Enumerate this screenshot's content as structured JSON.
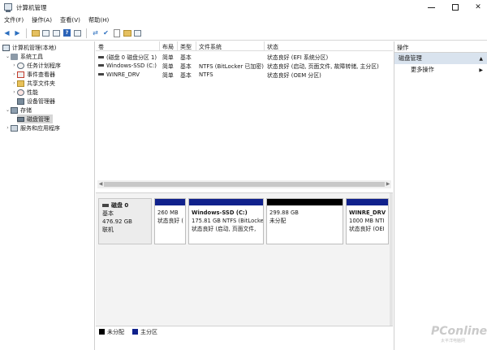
{
  "window": {
    "title": "计算机管理"
  },
  "menu": [
    "文件(F)",
    "操作(A)",
    "查看(V)",
    "帮助(H)"
  ],
  "tree": {
    "root": "计算机管理(本地)",
    "system_tools": "系统工具",
    "task_scheduler": "任务计划程序",
    "event_viewer": "事件查看器",
    "shared_folders": "共享文件夹",
    "performance": "性能",
    "device_manager": "设备管理器",
    "storage": "存储",
    "disk_management": "磁盘管理",
    "services": "服务和应用程序"
  },
  "columns": [
    "卷",
    "布局",
    "类型",
    "文件系统",
    "状态"
  ],
  "volumes": [
    {
      "name": "(磁盘 0 磁盘分区 1)",
      "layout": "简单",
      "type": "基本",
      "fs": "",
      "status": "状态良好 (EFI 系统分区)"
    },
    {
      "name": "Windows-SSD (C:)",
      "layout": "简单",
      "type": "基本",
      "fs": "NTFS (BitLocker 已加密)",
      "status": "状态良好 (启动, 页面文件, 故障转储, 主分区)"
    },
    {
      "name": "WINRE_DRV",
      "layout": "简单",
      "type": "基本",
      "fs": "NTFS",
      "status": "状态良好 (OEM 分区)"
    }
  ],
  "disk": {
    "name": "磁盘 0",
    "type": "基本",
    "size": "476.92 GB",
    "status": "联机"
  },
  "partitions": [
    {
      "title": "",
      "size": "260 MB",
      "status": "状态良好 (",
      "kind": "primary"
    },
    {
      "title": "Windows-SSD  (C:)",
      "size": "175.81 GB NTFS (BitLocke",
      "status": "状态良好 (启动, 页面文件,",
      "kind": "primary"
    },
    {
      "title": "",
      "size": "299.88 GB",
      "status": "未分配",
      "kind": "unalloc"
    },
    {
      "title": "WINRE_DRV",
      "size": "1000 MB NTI",
      "status": "状态良好 (OEI",
      "kind": "primary"
    }
  ],
  "legend": [
    {
      "label": "未分配",
      "color": "#000000"
    },
    {
      "label": "主分区",
      "color": "#10218c"
    }
  ],
  "actions": {
    "header": "操作",
    "section": "磁盘管理",
    "more": "更多操作"
  },
  "watermark": {
    "brand": "PConline",
    "sub": "太平洋电脑网"
  }
}
